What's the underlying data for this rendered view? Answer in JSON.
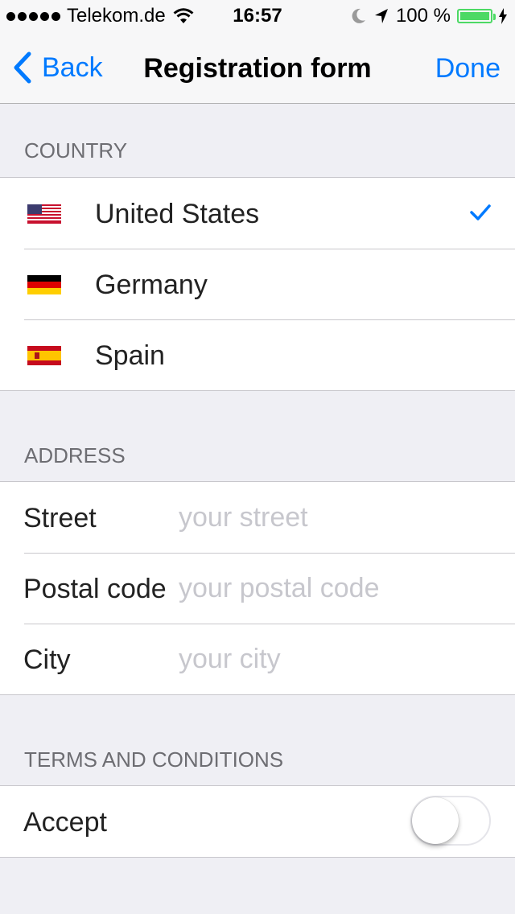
{
  "status_bar": {
    "carrier": "Telekom.de",
    "time": "16:57",
    "battery": "100 %",
    "battery_level": 1.0,
    "icons": [
      "signal-dots",
      "wifi-icon",
      "moon-icon",
      "location-arrow-icon",
      "battery-icon",
      "charging-bolt-icon"
    ]
  },
  "nav": {
    "back_label": "Back",
    "title": "Registration form",
    "done_label": "Done"
  },
  "country": {
    "header": "COUNTRY",
    "items": [
      {
        "name": "United States",
        "flag": "us-flag",
        "selected": true
      },
      {
        "name": "Germany",
        "flag": "de-flag",
        "selected": false
      },
      {
        "name": "Spain",
        "flag": "es-flag",
        "selected": false
      }
    ],
    "accent": "#007aff"
  },
  "address": {
    "header": "ADDRESS",
    "fields": [
      {
        "label": "Street",
        "value": "",
        "placeholder": "your street"
      },
      {
        "label": "Postal code",
        "value": "",
        "placeholder": "your postal code"
      },
      {
        "label": "City",
        "value": "",
        "placeholder": "your city"
      }
    ]
  },
  "terms": {
    "header": "TERMS AND CONDITIONS",
    "accept_label": "Accept",
    "accepted": false
  }
}
